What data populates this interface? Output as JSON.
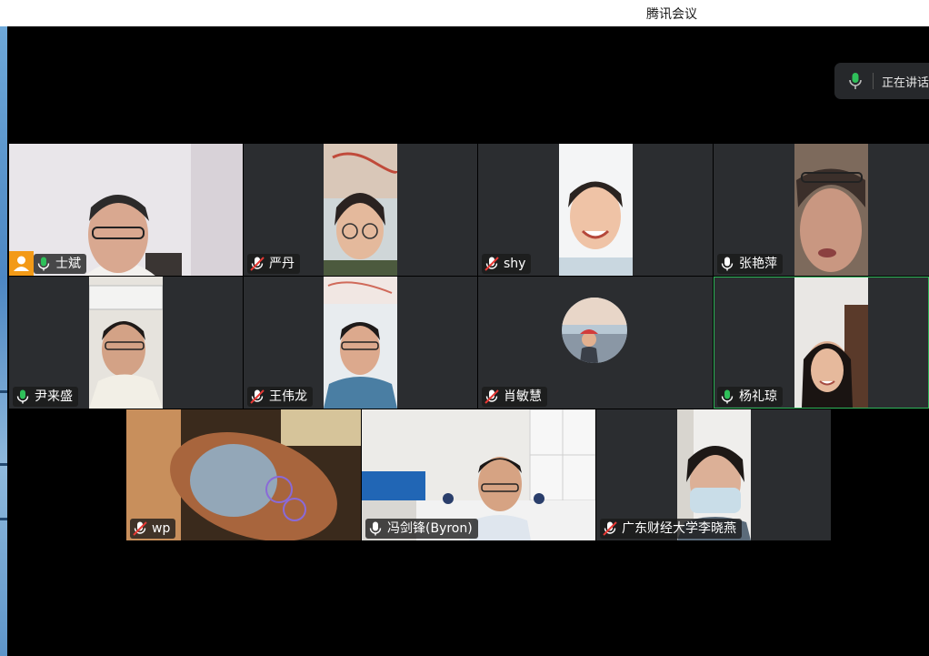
{
  "window": {
    "title": "腾讯会议"
  },
  "speaking_indicator": {
    "label": "正在讲话",
    "mic_color": "#2fc05a"
  },
  "colors": {
    "accent_green": "#2fb55a",
    "host_badge": "#f39a17",
    "tile_bg": "#2b2d30"
  },
  "participants": [
    {
      "name": "士斌",
      "mic": "on",
      "host": true
    },
    {
      "name": "严丹",
      "mic": "muted"
    },
    {
      "name": "shy",
      "mic": "muted"
    },
    {
      "name": "张艳萍",
      "mic": "on-white"
    },
    {
      "name": "尹来盛",
      "mic": "on"
    },
    {
      "name": "王伟龙",
      "mic": "muted"
    },
    {
      "name": "肖敏慧",
      "mic": "muted",
      "avatar": true
    },
    {
      "name": "杨礼琼",
      "mic": "on",
      "active_speaker": true
    },
    {
      "name": "wp",
      "mic": "muted"
    },
    {
      "name": "冯剑锋(Byron)",
      "mic": "on-white"
    },
    {
      "name": "广东财经大学李晓燕",
      "mic": "muted"
    }
  ]
}
